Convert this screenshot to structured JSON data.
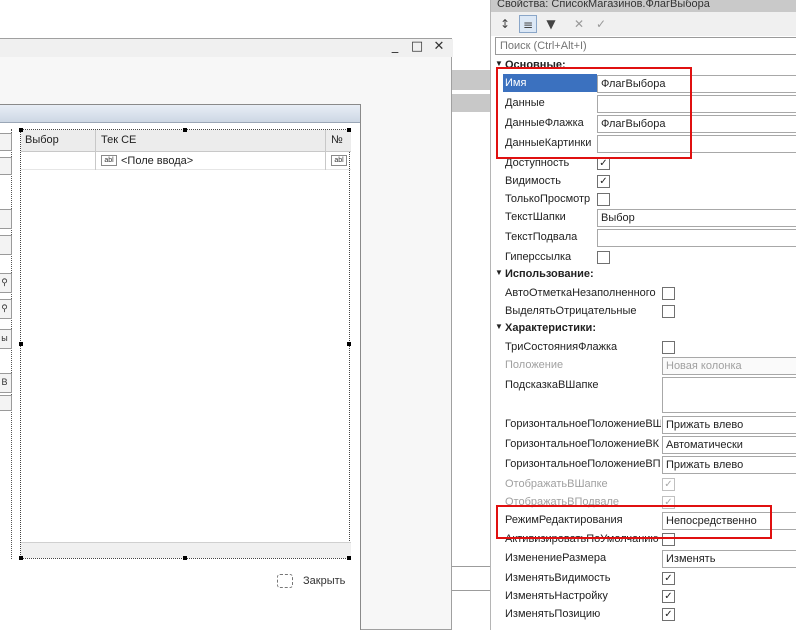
{
  "designer": {
    "window_buttons": [
      "_",
      "□",
      "✕"
    ],
    "table": {
      "columns": [
        "Выбор",
        "Тек СЕ",
        "№"
      ],
      "row_cell": "<Поле ввода>",
      "abl_icon_text": "abl"
    },
    "left_strip": {
      "bottom_label": "В",
      "row_label": "ы"
    },
    "close_label": "Закрыть"
  },
  "properties": {
    "title": "Свойства: СписокМагазинов.ФлагВыбора",
    "search_placeholder": "Поиск (Ctrl+Alt+I)",
    "groups": {
      "main": "Основные:",
      "usage": "Использование:",
      "characteristics": "Характеристики:"
    },
    "rows": {
      "name": {
        "label": "Имя",
        "value": "ФлагВыбора"
      },
      "data": {
        "label": "Данные",
        "value": ""
      },
      "flag_data": {
        "label": "ДанныеФлажка",
        "value": "ФлагВыбора"
      },
      "picture_data": {
        "label": "ДанныеКартинки",
        "value": ""
      },
      "availability": {
        "label": "Доступность",
        "checked": true
      },
      "visibility": {
        "label": "Видимость",
        "checked": true
      },
      "readonly": {
        "label": "ТолькоПросмотр",
        "checked": false
      },
      "header_text": {
        "label": "ТекстШапки",
        "value": "Выбор"
      },
      "footer_text": {
        "label": "ТекстПодвала",
        "value": ""
      },
      "hyperlink": {
        "label": "Гиперссылка",
        "checked": false
      },
      "auto_mark": {
        "label": "АвтоОтметкаНезаполненного",
        "checked": false
      },
      "highlight_neg": {
        "label": "ВыделятьОтрицательные",
        "checked": false
      },
      "three_state": {
        "label": "ТриСостоянияФлажка",
        "checked": false
      },
      "position": {
        "label": "Положение",
        "value": "Новая колонка"
      },
      "header_hint": {
        "label": "ПодсказкаВШапке",
        "value": ""
      },
      "h_align_header": {
        "label": "ГоризонтальноеПоложениеВШ",
        "value": "Прижать влево"
      },
      "h_align_column": {
        "label": "ГоризонтальноеПоложениеВК",
        "value": "Автоматически"
      },
      "h_align_footer": {
        "label": "ГоризонтальноеПоложениеВП",
        "value": "Прижать влево"
      },
      "show_in_header": {
        "label": "ОтображатьВШапке",
        "checked": true
      },
      "show_in_footer": {
        "label": "ОтображатьВПодвале",
        "checked": true
      },
      "edit_mode": {
        "label": "РежимРедактирования",
        "value": "Непосредственно"
      },
      "activate_default": {
        "label": "АктивизироватьПоУмолчанию",
        "checked": false
      },
      "resize": {
        "label": "ИзменениеРазмера",
        "value": "Изменять"
      },
      "change_visibility": {
        "label": "ИзменятьВидимость",
        "checked": true
      },
      "change_setting": {
        "label": "ИзменятьНастройку",
        "checked": true
      },
      "change_position": {
        "label": "ИзменятьПозицию",
        "checked": true
      }
    }
  },
  "colors": {
    "highlight_box": "#e01010",
    "selection": "#3b71bf"
  }
}
